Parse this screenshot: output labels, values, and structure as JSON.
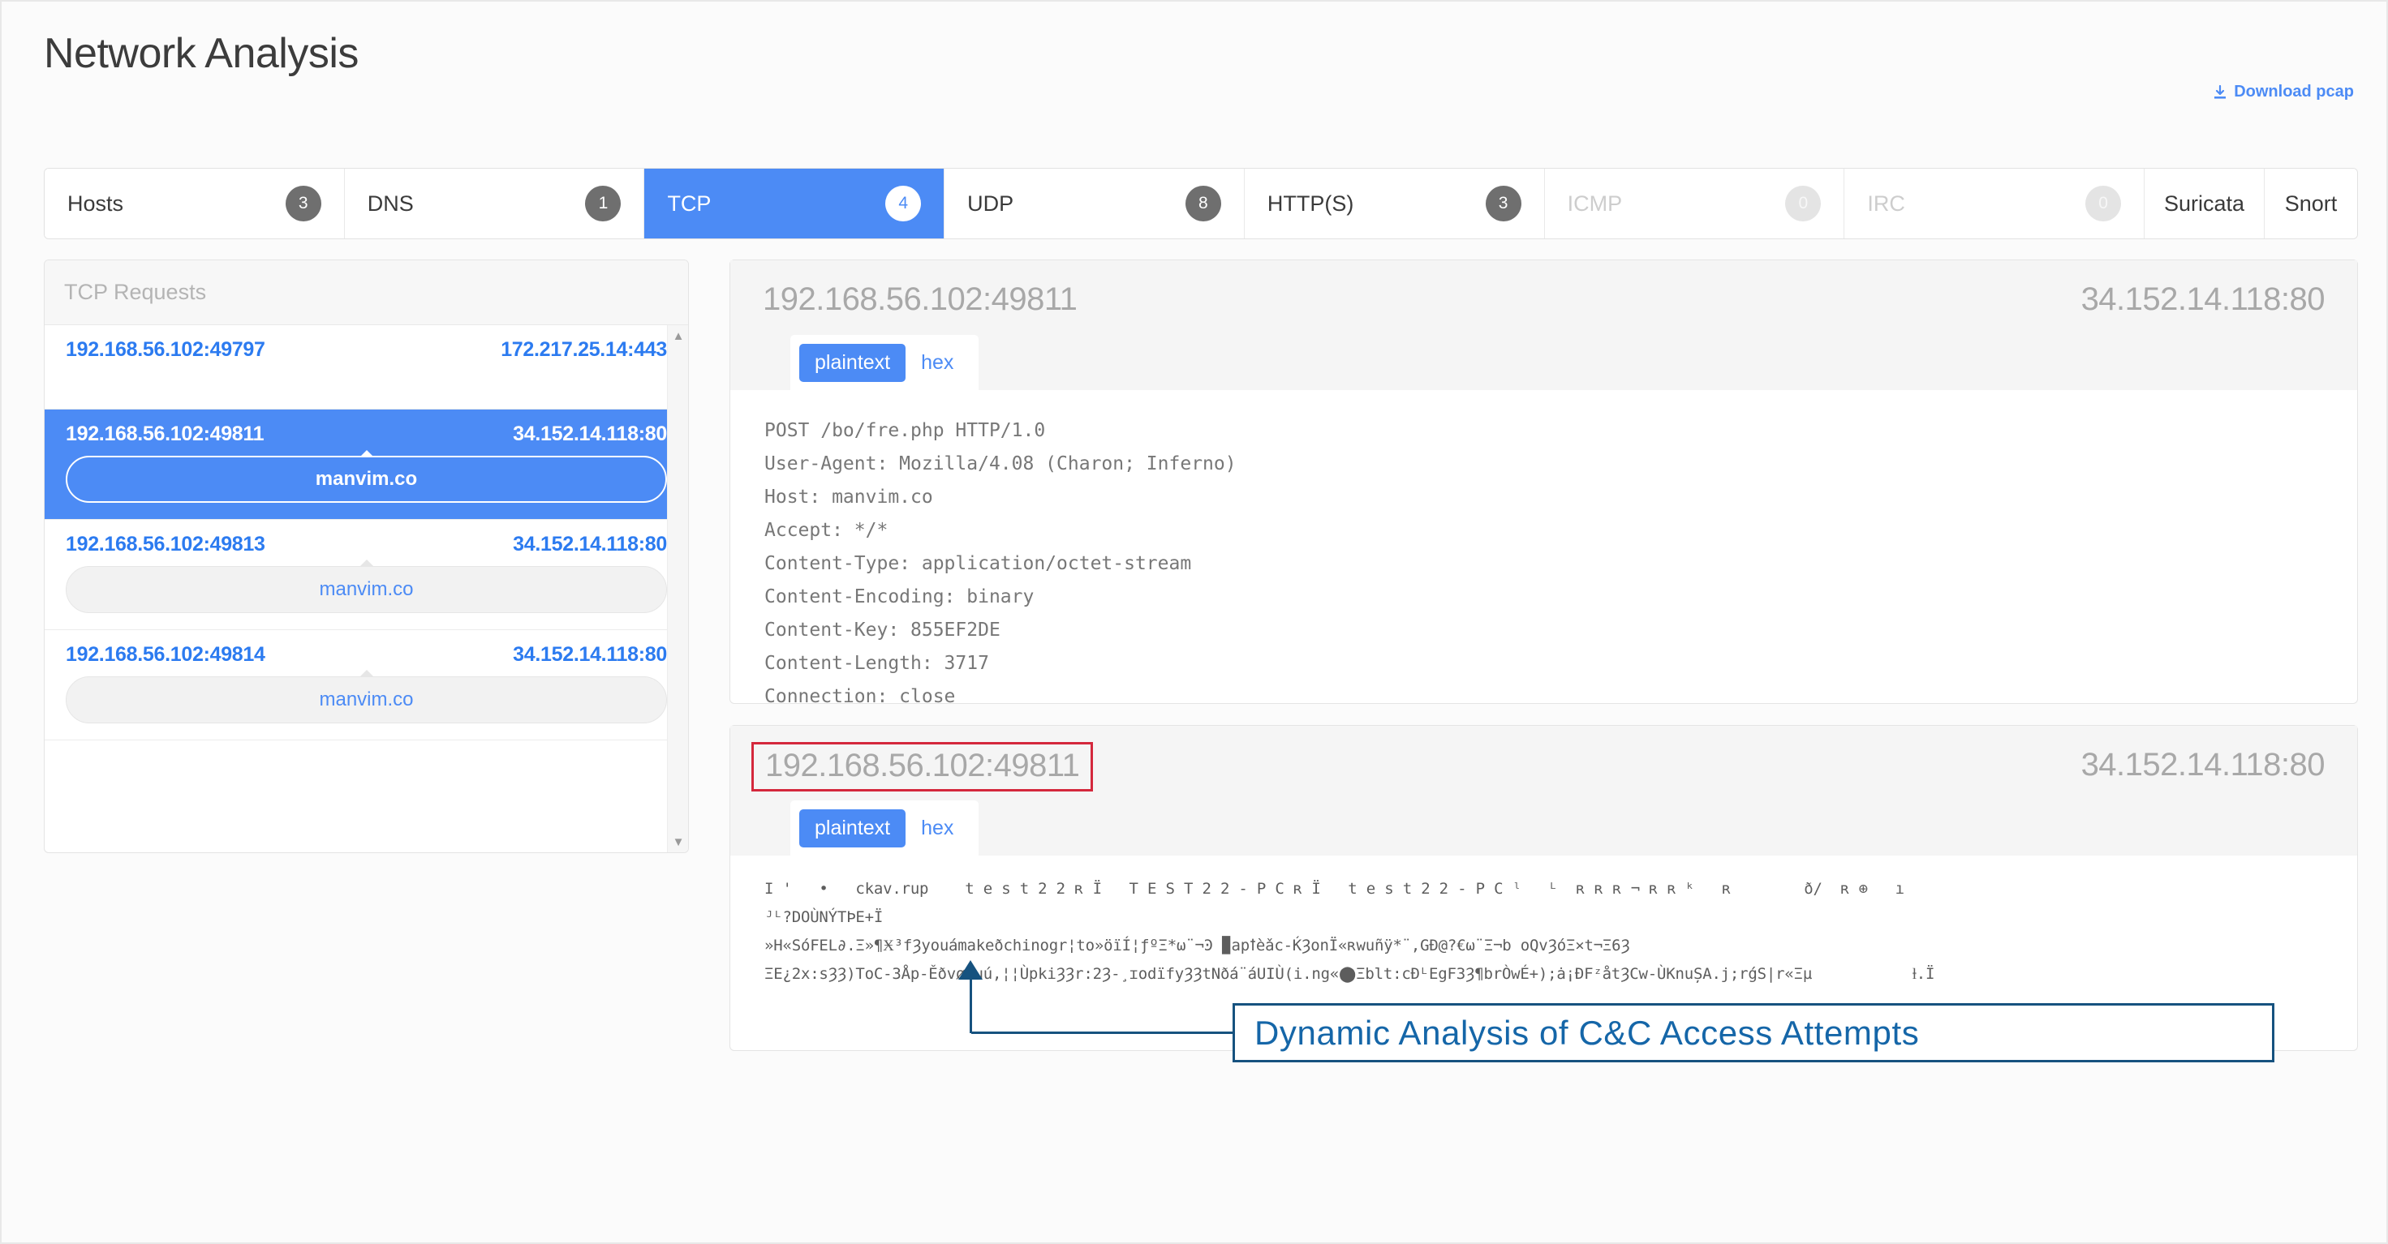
{
  "header": {
    "title": "Network Analysis",
    "download_label": "Download pcap",
    "download_icon": "download-icon"
  },
  "tabs": [
    {
      "label": "Hosts",
      "count": "3",
      "state": "normal"
    },
    {
      "label": "DNS",
      "count": "1",
      "state": "normal"
    },
    {
      "label": "TCP",
      "count": "4",
      "state": "active"
    },
    {
      "label": "UDP",
      "count": "8",
      "state": "normal"
    },
    {
      "label": "HTTP(S)",
      "count": "3",
      "state": "normal"
    },
    {
      "label": "ICMP",
      "count": "0",
      "state": "disabled"
    },
    {
      "label": "IRC",
      "count": "0",
      "state": "disabled"
    },
    {
      "label": "Suricata",
      "count": "",
      "state": "plain"
    },
    {
      "label": "Snort",
      "count": "",
      "state": "plain"
    }
  ],
  "sidebar": {
    "title": "TCP Requests",
    "scroll_up_icon": "chevron-up-icon",
    "scroll_down_icon": "chevron-down-icon",
    "requests": [
      {
        "src": "192.168.56.102:49797",
        "dst": "172.217.25.14:443",
        "domain": "",
        "selected": false
      },
      {
        "src": "192.168.56.102:49811",
        "dst": "34.152.14.118:80",
        "domain": "manvim.co",
        "selected": true
      },
      {
        "src": "192.168.56.102:49813",
        "dst": "34.152.14.118:80",
        "domain": "manvim.co",
        "selected": false
      },
      {
        "src": "192.168.56.102:49814",
        "dst": "34.152.14.118:80",
        "domain": "manvim.co",
        "selected": false
      }
    ]
  },
  "streams": [
    {
      "src": "192.168.56.102:49811",
      "dst": "34.152.14.118:80",
      "format_tabs": [
        {
          "label": "plaintext",
          "active": true
        },
        {
          "label": "hex",
          "active": false
        }
      ],
      "body": "POST /bo/fre.php HTTP/1.0\nUser-Agent: Mozilla/4.08 (Charon; Inferno)\nHost: manvim.co\nAccept: */*\nContent-Type: application/octet-stream\nContent-Encoding: binary\nContent-Key: 855EF2DE\nContent-Length: 3717\nConnection: close",
      "highlight_src": false
    },
    {
      "src": "192.168.56.102:49811",
      "dst": "34.152.14.118:80",
      "format_tabs": [
        {
          "label": "plaintext",
          "active": true
        },
        {
          "label": "hex",
          "active": false
        }
      ],
      "body": "I '   •   ckav.rup    t e s t 2 2 ʀ Ï   T E S T 2 2 - P C ʀ Ï   t e s t 2 2 - P C ˡ   ᴸ  ʀ ʀ ʀ ¬ ʀ ʀ ᵏ   ʀ        ð/  ʀ ⊕   ı\nᴶᴸ?DOÙNÝTÞE+Ï\n»H«SóFEL∂.Ξ»¶Ӿ³fȜyouámakeðchinogr¦to»öïÍ¦ƒºΞ*ω¨¬Ͽ ▉apꝉèǎc-ЌȜonÏ«ʀwuñÿ*¨,GÐ@?€ω¨Ξ¬b oQvȜóΞ×t¬Ξ6Ȝ\nΞE¿2x:sȜȜ)ToC-ЗÅp-ĚðvøIuú,¦¦ÙpkiȜȜr:2Ȝ-¸ɪodïfyȜȜtNðá¨áUIÙ(i.ng«⬤Ξblt:cÐᴸEgFЗȜ¶brÒwÉ+);ȧ¡ÐFᶻåtȜCw-ÙKnuȘA.j;rǵS|r«Ξµ           ⱡ.Ï",
      "highlight_src": true
    }
  ],
  "annotation": {
    "text": "Dynamic Analysis of C&C Access Attempts"
  },
  "colors": {
    "accent_blue": "#4c8bf5",
    "link_blue": "#2c7bf0",
    "badge_gray": "#6f6f6f",
    "highlight_red": "#d4283c",
    "annotation_blue": "#1566a8"
  }
}
